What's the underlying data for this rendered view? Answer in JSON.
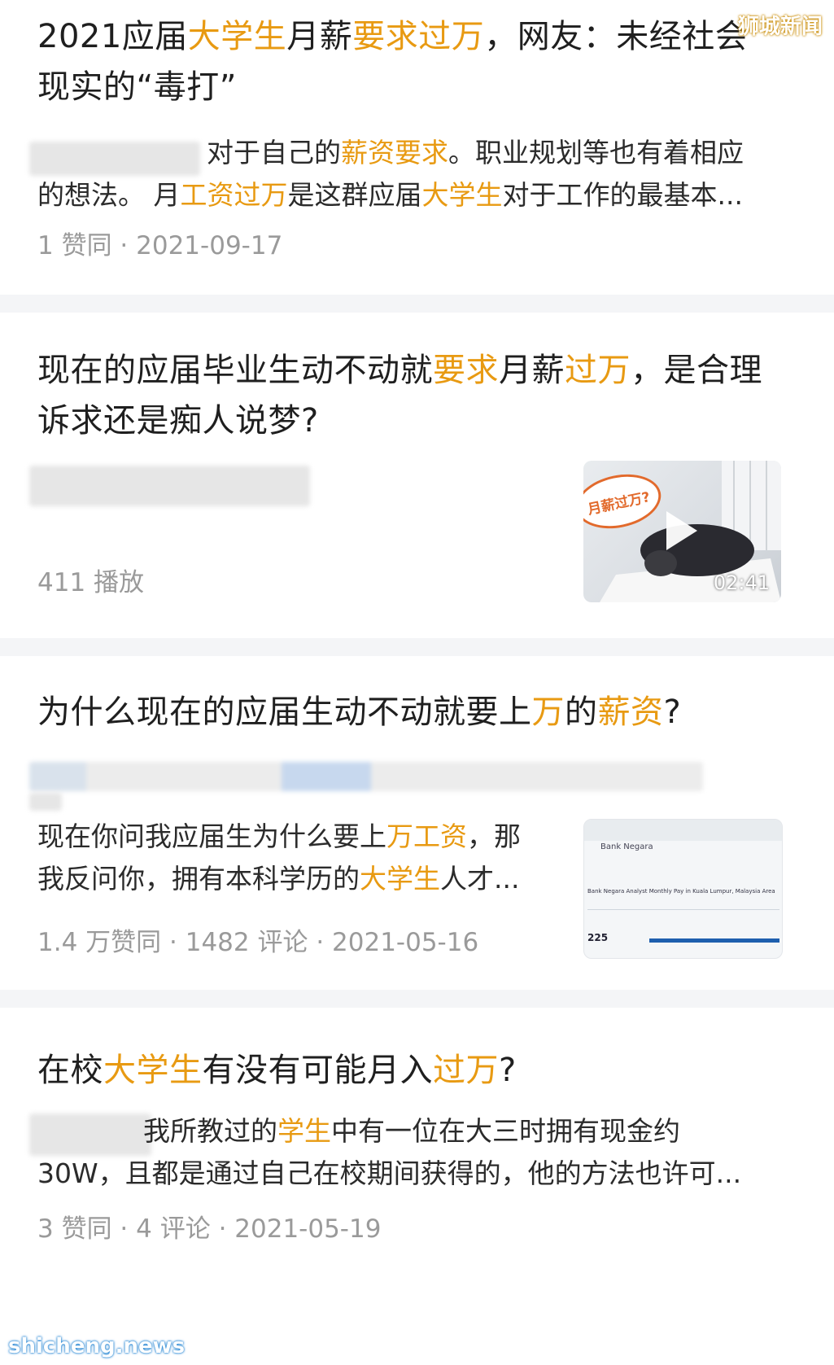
{
  "watermarks": {
    "top": "狮城新闻",
    "bottom": "shicheng.news"
  },
  "colors": {
    "highlight": "#e89a12",
    "meta": "#9a9a9a",
    "separator": "#f4f5f7"
  },
  "results": [
    {
      "title": [
        "2021应届",
        "大学生",
        "月薪",
        "要求过万",
        "，网友：未经社会",
        "现实的“毒打”"
      ],
      "snippet": [
        "对于自己的",
        "薪资要求",
        "。职业规划等也有着相应",
        "的想法。 月",
        "工资过万",
        "是这群应届",
        "大学生",
        "对于工作的最基本..."
      ],
      "meta": "1 赞同 · 2021-09-17"
    },
    {
      "title": [
        "现在的应届毕业生动不动就",
        "要求",
        "月薪",
        "过万",
        "，是合理",
        "诉求还是痴人说梦?"
      ],
      "meta": "411 播放",
      "video": {
        "badge": "月薪过万?",
        "duration": "02:41",
        "icon": "play-icon"
      }
    },
    {
      "title": [
        "为什么现在的应届生动不动就要上",
        "万",
        "的",
        "薪资",
        "?"
      ],
      "snippet": [
        "现在你问我应届生为什么要上",
        "万工资",
        "，那",
        "我反问你，拥有本科学历的",
        "大学生",
        "人才..."
      ],
      "meta": "1.4 万赞同 · 1482 评论 · 2021-05-16",
      "thumb": {
        "heading": "Bank Negara",
        "caption": "Bank Negara Analyst Monthly Pay in Kuala Lumpur, Malaysia Area",
        "value": "225"
      }
    },
    {
      "title": [
        "在校",
        "大学生",
        "有没有可能月入",
        "过万",
        "?"
      ],
      "snippet": [
        "我所教过的",
        "学生",
        "中有一位在大三时拥有现金约",
        "30W，且都是通过自己在校期间获得的，他的方法也许可..."
      ],
      "meta": "3 赞同 · 4 评论 · 2021-05-19"
    }
  ]
}
